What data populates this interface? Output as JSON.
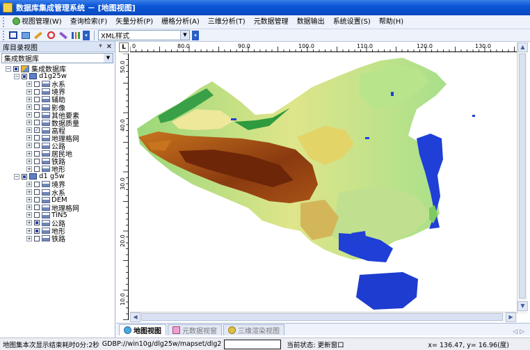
{
  "window": {
    "title": "数据库集成管理系统 － [地图视图]"
  },
  "menu": {
    "items": [
      {
        "label": "视图管理(W)",
        "icon": "globe-icon"
      },
      {
        "label": "查询检索(F)"
      },
      {
        "label": "矢量分析(P)"
      },
      {
        "label": "栅格分析(A)"
      },
      {
        "label": "三维分析(T)"
      },
      {
        "label": "元数据管理"
      },
      {
        "label": "数据输出"
      },
      {
        "label": "系统设置(S)"
      },
      {
        "label": "帮助(H)"
      }
    ]
  },
  "toolbar": {
    "style_value": "XML样式"
  },
  "left_panel": {
    "title": "库目录视图",
    "pin_icon": "pin-icon",
    "close_icon": "close-icon",
    "database_select": "集成数据库",
    "root": "集成数据库",
    "groups": [
      {
        "name": "d1g25w",
        "layers": [
          {
            "name": "水系",
            "state": "off"
          },
          {
            "name": "境界",
            "state": "off"
          },
          {
            "name": "辅助",
            "state": "off"
          },
          {
            "name": "影像",
            "state": "off"
          },
          {
            "name": "其他要素",
            "state": "off"
          },
          {
            "name": "数据质量",
            "state": "off"
          },
          {
            "name": "高程",
            "state": "on"
          },
          {
            "name": "地理格网",
            "state": "off"
          },
          {
            "name": "公路",
            "state": "off"
          },
          {
            "name": "居民地",
            "state": "off"
          },
          {
            "name": "铁路",
            "state": "off"
          },
          {
            "name": "地形",
            "state": "off"
          }
        ]
      },
      {
        "name": "d1 g5w",
        "layers": [
          {
            "name": "境界",
            "state": "off"
          },
          {
            "name": "水系",
            "state": "off"
          },
          {
            "name": "DEM",
            "state": "off"
          },
          {
            "name": "地理格网",
            "state": "off"
          },
          {
            "name": "TIN5",
            "state": "off"
          },
          {
            "name": "公路",
            "state": "partial"
          },
          {
            "name": "地形",
            "state": "partial"
          },
          {
            "name": "铁路",
            "state": "off"
          }
        ]
      }
    ]
  },
  "map": {
    "corner_label": "L",
    "ruler_top_labels": [
      "0",
      "80.0",
      "90.0",
      "100.0",
      "110.0",
      "120.0",
      "130.0"
    ],
    "ruler_left_labels": [
      "50.0",
      "40.0",
      "30.0",
      "20.0",
      "10.0"
    ],
    "colors": {
      "high": "#7a2a0c",
      "mid_high": "#c8741e",
      "mid": "#e8d96a",
      "low": "#9ad87a",
      "lowest": "#2f9a3e",
      "water": "#1f3fd6"
    }
  },
  "tabs": [
    {
      "label": "地图视图",
      "active": true
    },
    {
      "label": "元数据视窗",
      "active": false
    },
    {
      "label": "三维渲染视图",
      "active": false
    }
  ],
  "status": {
    "render_time": "地图集本次显示结束耗时0分:2秒",
    "path": "GDBP://win10g/dlg25w/mapset/dlg2",
    "state_label": "当前状态: 更新窗口",
    "coords": "x= 136.47, y= 16.96(度)"
  }
}
